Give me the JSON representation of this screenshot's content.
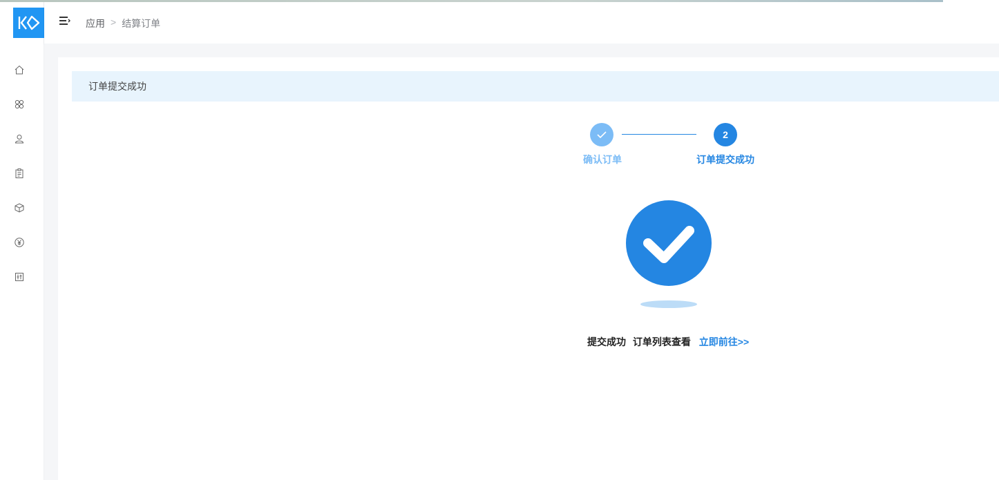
{
  "header": {
    "breadcrumb": [
      "应用",
      "结算订单"
    ],
    "breadcrumb_separator": ">"
  },
  "sidebar": {
    "items": [
      {
        "icon": "home-icon"
      },
      {
        "icon": "apps-icon"
      },
      {
        "icon": "user-icon"
      },
      {
        "icon": "clipboard-icon"
      },
      {
        "icon": "box-icon"
      },
      {
        "icon": "yuan-icon"
      },
      {
        "icon": "report-icon"
      }
    ]
  },
  "card": {
    "title": "订单提交成功"
  },
  "steps": [
    {
      "label": "确认订单",
      "status": "done"
    },
    {
      "number": "2",
      "label": "订单提交成功",
      "status": "active"
    }
  ],
  "result": {
    "status_text": "提交成功",
    "hint_text": "订单列表查看",
    "link_text": "立即前往>>"
  },
  "colors": {
    "logo": "#2196f3",
    "primary": "#2486e2",
    "step_done": "#7cbcf6",
    "header_banner": "#e8f4fd"
  }
}
